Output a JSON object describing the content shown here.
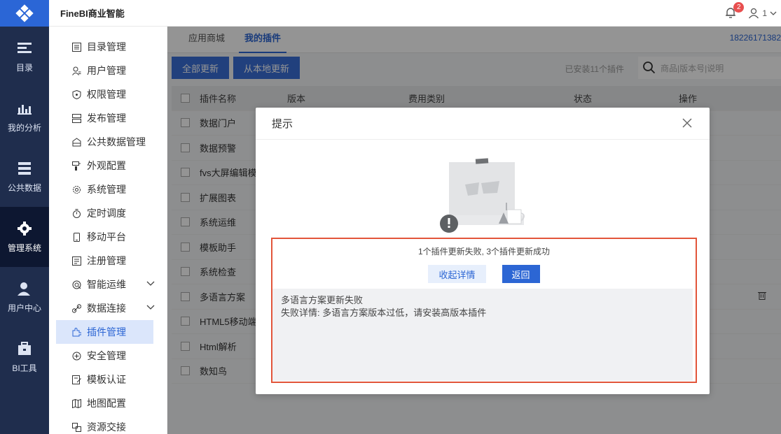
{
  "app": {
    "title": "FineBI商业智能"
  },
  "header": {
    "notification_count": "2",
    "user_label": "1"
  },
  "leftnav": [
    {
      "label": "目录",
      "icon": "catalog-icon"
    },
    {
      "label": "我的分析",
      "icon": "analysis-icon"
    },
    {
      "label": "公共数据",
      "icon": "public-data-icon"
    },
    {
      "label": "管理系统",
      "icon": "gear-icon"
    },
    {
      "label": "用户中心",
      "icon": "user-center-icon"
    },
    {
      "label": "BI工具",
      "icon": "toolbox-icon"
    }
  ],
  "submenu": [
    {
      "label": "目录管理",
      "icon": "list-icon"
    },
    {
      "label": "用户管理",
      "icon": "user-icon"
    },
    {
      "label": "权限管理",
      "icon": "shield-icon"
    },
    {
      "label": "发布管理",
      "icon": "publish-icon"
    },
    {
      "label": "公共数据管理",
      "icon": "database-icon"
    },
    {
      "label": "外观配置",
      "icon": "brush-icon"
    },
    {
      "label": "系统管理",
      "icon": "settings-icon"
    },
    {
      "label": "定时调度",
      "icon": "timer-icon"
    },
    {
      "label": "移动平台",
      "icon": "mobile-icon"
    },
    {
      "label": "注册管理",
      "icon": "register-icon"
    },
    {
      "label": "智能运维",
      "icon": "ops-icon"
    },
    {
      "label": "数据连接",
      "icon": "link-icon"
    },
    {
      "label": "插件管理",
      "icon": "plugin-icon"
    },
    {
      "label": "安全管理",
      "icon": "security-icon"
    },
    {
      "label": "模板认证",
      "icon": "template-icon"
    },
    {
      "label": "地图配置",
      "icon": "map-icon"
    },
    {
      "label": "资源交接",
      "icon": "handover-icon"
    }
  ],
  "main": {
    "tabs": [
      "应用商城",
      "我的插件"
    ],
    "phone": "18226171382",
    "update_all_label": "全部更新",
    "update_local_label": "从本地更新",
    "installed_text": "已安装11个插件",
    "search_placeholder": "商品|版本号|说明",
    "columns": [
      "插件名称",
      "版本",
      "费用类别",
      "状态",
      "操作"
    ],
    "rows": [
      "数据门户",
      "数据预警",
      "fvs大屏编辑模",
      "扩展图表",
      "系统运维",
      "模板助手",
      "系统检查",
      "多语言方案",
      "HTML5移动端",
      "Html解析",
      "数知鸟"
    ]
  },
  "modal": {
    "title": "提示",
    "summary": "1个插件更新失败, 3个插件更新成功",
    "collapse_label": "收起详情",
    "back_label": "返回",
    "detail_line1": "多语言方案更新失败",
    "detail_line2": "失败详情: 多语言方案版本过低，请安装高版本插件"
  },
  "colors": {
    "accent": "#2c66d4",
    "nav_bg": "#1f2d4d",
    "highlight_border": "#e2553a"
  }
}
